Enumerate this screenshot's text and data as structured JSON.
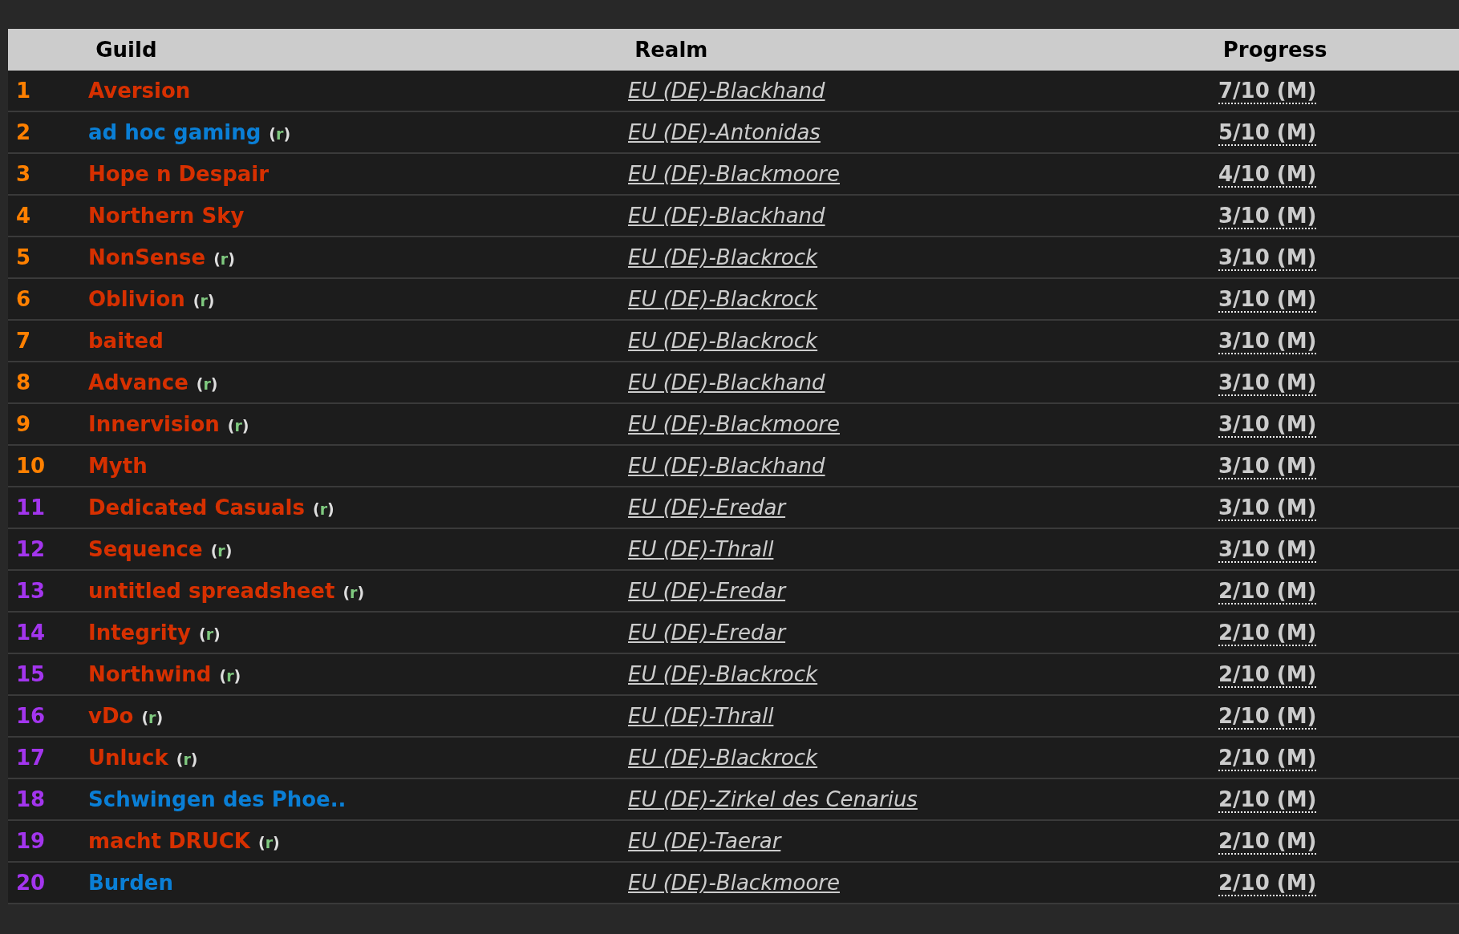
{
  "table": {
    "columns": [
      "Guild",
      "Realm",
      "Progress"
    ],
    "rows": [
      {
        "rank": {
          "text": "1",
          "color": "#ff8000"
        },
        "guild": {
          "text": "Aversion",
          "color": "#d63000"
        },
        "realm": "EU (DE)-Blackhand",
        "progress": "7/10 (M)"
      },
      {
        "rank": {
          "text": "2",
          "color": "#ff8000"
        },
        "guild": {
          "text": "ad hoc gaming",
          "color": "#0a7fd6",
          "tag": "(r)"
        },
        "realm": "EU (DE)-Antonidas",
        "progress": "5/10 (M)"
      },
      {
        "rank": {
          "text": "3",
          "color": "#ff8000"
        },
        "guild": {
          "text": "Hope n Despair",
          "color": "#d63000"
        },
        "realm": "EU (DE)-Blackmoore",
        "progress": "4/10 (M)"
      },
      {
        "rank": {
          "text": "4",
          "color": "#ff8000"
        },
        "guild": {
          "text": "Northern Sky",
          "color": "#d63000"
        },
        "realm": "EU (DE)-Blackhand",
        "progress": "3/10 (M)"
      },
      {
        "rank": {
          "text": "5",
          "color": "#ff8000"
        },
        "guild": {
          "text": "NonSense",
          "color": "#d63000",
          "tag": "(r)"
        },
        "realm": "EU (DE)-Blackrock",
        "progress": "3/10 (M)"
      },
      {
        "rank": {
          "text": "6",
          "color": "#ff8000"
        },
        "guild": {
          "text": "Oblivion",
          "color": "#d63000",
          "tag": "(r)"
        },
        "realm": "EU (DE)-Blackrock",
        "progress": "3/10 (M)"
      },
      {
        "rank": {
          "text": "7",
          "color": "#ff8000"
        },
        "guild": {
          "text": "baited",
          "color": "#d63000"
        },
        "realm": "EU (DE)-Blackrock",
        "progress": "3/10 (M)"
      },
      {
        "rank": {
          "text": "8",
          "color": "#ff8000"
        },
        "guild": {
          "text": "Advance",
          "color": "#d63000",
          "tag": "(r)"
        },
        "realm": "EU (DE)-Blackhand",
        "progress": "3/10 (M)"
      },
      {
        "rank": {
          "text": "9",
          "color": "#ff8000"
        },
        "guild": {
          "text": "Innervision",
          "color": "#d63000",
          "tag": "(r)"
        },
        "realm": "EU (DE)-Blackmoore",
        "progress": "3/10 (M)"
      },
      {
        "rank": {
          "text": "10",
          "color": "#ff8000"
        },
        "guild": {
          "text": "Myth",
          "color": "#d63000"
        },
        "realm": "EU (DE)-Blackhand",
        "progress": "3/10 (M)"
      },
      {
        "rank": {
          "text": "11",
          "color": "#a335ee"
        },
        "guild": {
          "text": "Dedicated Casuals",
          "color": "#d63000",
          "tag": "(r)"
        },
        "realm": "EU (DE)-Eredar",
        "progress": "3/10 (M)"
      },
      {
        "rank": {
          "text": "12",
          "color": "#a335ee"
        },
        "guild": {
          "text": "Sequence",
          "color": "#d63000",
          "tag": "(r)"
        },
        "realm": "EU (DE)-Thrall",
        "progress": "3/10 (M)"
      },
      {
        "rank": {
          "text": "13",
          "color": "#a335ee"
        },
        "guild": {
          "text": "untitled spreadsheet",
          "color": "#d63000",
          "tag": "(r)"
        },
        "realm": "EU (DE)-Eredar",
        "progress": "2/10 (M)"
      },
      {
        "rank": {
          "text": "14",
          "color": "#a335ee"
        },
        "guild": {
          "text": "Integrity",
          "color": "#d63000",
          "tag": "(r)"
        },
        "realm": "EU (DE)-Eredar",
        "progress": "2/10 (M)"
      },
      {
        "rank": {
          "text": "15",
          "color": "#a335ee"
        },
        "guild": {
          "text": "Northwind",
          "color": "#d63000",
          "tag": "(r)"
        },
        "realm": "EU (DE)-Blackrock",
        "progress": "2/10 (M)"
      },
      {
        "rank": {
          "text": "16",
          "color": "#a335ee"
        },
        "guild": {
          "text": "vDo",
          "color": "#d63000",
          "tag": "(r)"
        },
        "realm": "EU (DE)-Thrall",
        "progress": "2/10 (M)"
      },
      {
        "rank": {
          "text": "17",
          "color": "#a335ee"
        },
        "guild": {
          "text": "Unluck",
          "color": "#d63000",
          "tag": "(r)"
        },
        "realm": "EU (DE)-Blackrock",
        "progress": "2/10 (M)"
      },
      {
        "rank": {
          "text": "18",
          "color": "#a335ee"
        },
        "guild": {
          "text": "Schwingen des Phoe..",
          "color": "#0a7fd6"
        },
        "realm": "EU (DE)-Zirkel des Cenarius",
        "progress": "2/10 (M)"
      },
      {
        "rank": {
          "text": "19",
          "color": "#a335ee"
        },
        "guild": {
          "text": "macht DRUCK",
          "color": "#d63000",
          "tag": "(r)"
        },
        "realm": "EU (DE)-Taerar",
        "progress": "2/10 (M)"
      },
      {
        "rank": {
          "text": "20",
          "color": "#a335ee"
        },
        "guild": {
          "text": "Burden",
          "color": "#0a7fd6"
        },
        "realm": "EU (DE)-Blackmoore",
        "progress": "2/10 (M)"
      }
    ]
  }
}
